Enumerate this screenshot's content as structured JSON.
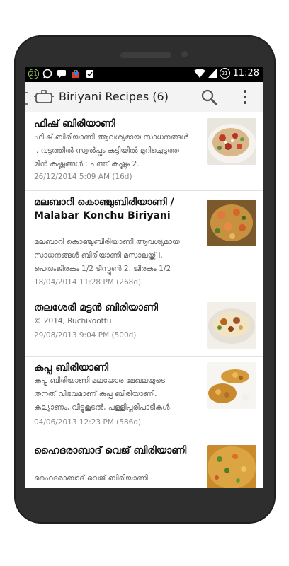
{
  "status_bar": {
    "badge": "21",
    "time": "11:28",
    "battery_percent": "21",
    "icons": [
      "notification-badge-icon",
      "whatsapp-icon",
      "message-icon",
      "bag-icon",
      "clipboard-check-icon",
      "wifi-icon",
      "signal-icon",
      "battery-icon"
    ]
  },
  "app_bar": {
    "title": "Biriyani Recipes (6)",
    "icons": [
      "back-icon",
      "cooking-pot-icon",
      "search-icon",
      "more-vert-icon"
    ]
  },
  "recipes": [
    {
      "title": "ഫിഷ് ബിരിയാണി",
      "desc": [
        "ഫിഷ് ബിരിയാണി ആവശ്യമായ സാധനങ്ങൾ",
        "l. വട്ടത്തിൽ സ്വൽപ്പം കട്ടിയിൽ മുറിച്ചെടുത്ത",
        "മീൻ കഷ്ണങ്ങൾ : പത്ത് കഷ്ണം 2."
      ],
      "date": "26/12/2014 5:09 AM (16d)"
    },
    {
      "title": "മലബാറി കൊഞ്ചുബിരിയാണി / Malabar Konchu Biriyani",
      "desc": [
        "മലബാറി കൊഞ്ചുബിരിയാണി ആവശ്യമായ",
        "സാധനങ്ങൾ ബിരിയാണി മസാലയ്ക്ക് l.",
        "പെരുംജീരകം 1/2 ടീസ്പൂൺ 2. ജീരകം 1/2"
      ],
      "date": "18/04/2014 11:28 PM (268d)"
    },
    {
      "title": "തലശേരി മട്ടൻ ബിരിയാണി",
      "desc": [
        "© 2014, Ruchikoottu"
      ],
      "date": "29/08/2013 9:04 PM (500d)"
    },
    {
      "title": "കപ്പ ബിരിയാണി",
      "desc": [
        "കപ്പ ബിരിയാണി മലയോര മേഖലയുടെ",
        "തനത് വിഭവമാണ് കപ്പ ബിരിയാണി.",
        "കല്യാണം, വീട്ടുകൂടൽ, പള്ളിപ്പരിപാടികൾ"
      ],
      "date": "04/06/2013 12:23 PM (586d)"
    },
    {
      "title": "ഹൈദരാബാദ് വെജ് ബിരിയാണി",
      "desc": [
        "ഹൈദരാബാദ് വെജ് ബിരിയാണി"
      ],
      "date": ""
    }
  ],
  "colors": {
    "app_bar_bg": "#f3f3f3",
    "status_bar_bg": "#000000",
    "phone_body": "#2e2e2e",
    "title_text": "#111111",
    "desc_text": "#666666"
  }
}
